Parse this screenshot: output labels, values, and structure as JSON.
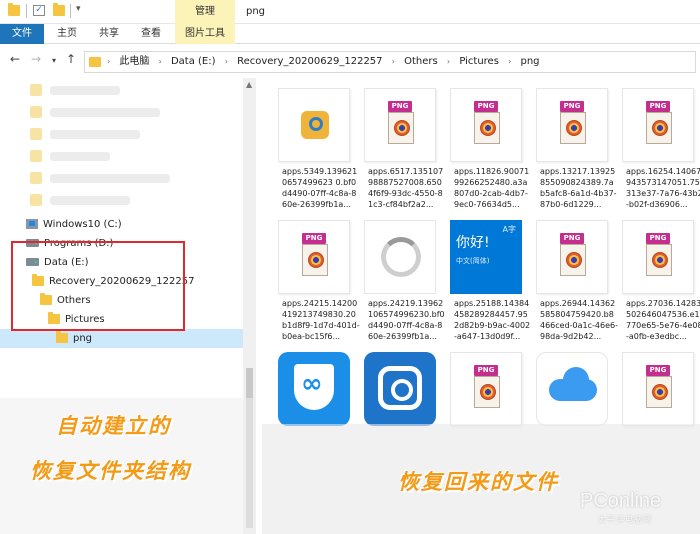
{
  "ribbon": {
    "manage_label": "管理",
    "window_title": "png",
    "tabs": {
      "file": "文件",
      "home": "主页",
      "share": "共享",
      "view": "查看",
      "picture_tools": "图片工具"
    }
  },
  "address": {
    "crumbs": [
      "此电脑",
      "Data (E:)",
      "Recovery_20200629_122257",
      "Others",
      "Pictures",
      "png"
    ]
  },
  "nav": {
    "drives": [
      {
        "label": "Windows10 (C:)"
      },
      {
        "label": "Programs (D:)"
      },
      {
        "label": "Data (E:)"
      }
    ],
    "tree": [
      {
        "label": "Recovery_20200629_122257"
      },
      {
        "label": "Others"
      },
      {
        "label": "Pictures"
      },
      {
        "label": "png"
      }
    ]
  },
  "files": [
    {
      "name": "apps.5349.1396210657499623 0.bf0d4490-07ff-4c8a-860e-26399fb1a...",
      "icon": "app-logo-icon"
    },
    {
      "name": "apps.6517.13510798887527008.6504f6f9-93dc-4550-81c3-cf84bf2a2...",
      "icon": "png-file-icon"
    },
    {
      "name": "apps.11826.9007199266252480.a3a807d0-2cab-4db7-9ec0-76634d5...",
      "icon": "png-file-icon"
    },
    {
      "name": "apps.13217.13925855090824389.7ab5afc8-6a1d-4b37-87b0-6d1229...",
      "icon": "png-file-icon"
    },
    {
      "name": "apps.16254.14067943573147051.75313e37-7a76-43b2-b02f-d36906...",
      "icon": "png-file-icon"
    },
    {
      "name": "apps.24215.14200419213749830.20b1d8f9-1d7d-401d-b0ea-bc15f6...",
      "icon": "png-file-icon"
    },
    {
      "name": "apps.24219.13962106574996230.bf0d4490-07ff-4c8a-860e-26399fb1a...",
      "icon": "loading-ring-icon"
    },
    {
      "name": "apps.25188.14384458289284457.952d82b9-b9ac-4002-a647-13d0d9f...",
      "icon": "translator-tile"
    },
    {
      "name": "apps.26944.14362585804759420.b8466ced-0a1c-46e6-98da-9d2b42...",
      "icon": "png-file-icon"
    },
    {
      "name": "apps.27036.14283502646047536.e1770e65-5e76-4e08-a0fb-e3edbc...",
      "icon": "png-file-icon"
    },
    {
      "name": "",
      "icon": "vpn-shield-icon"
    },
    {
      "name": "",
      "icon": "instagram-icon"
    },
    {
      "name": "",
      "icon": "png-file-icon"
    },
    {
      "name": "",
      "icon": "icloud-icon"
    },
    {
      "name": "",
      "icon": "png-file-icon"
    }
  ],
  "tiles": {
    "translate_main": "你好!",
    "translate_sub": "中文(简体)",
    "translate_corner": "A字"
  },
  "png_badge": "PNG",
  "captions": {
    "left_line1": "自动建立的",
    "left_line2": "恢复文件夹结构",
    "right": "恢复回来的文件"
  },
  "watermark": {
    "brand": "PConline",
    "sub": "太平洋电脑网"
  },
  "colors": {
    "file_tab": "#1f75b9",
    "manage_tab": "#fcf3b8",
    "caption_orange": "#f39a16",
    "highlight_red": "#e0282f"
  }
}
